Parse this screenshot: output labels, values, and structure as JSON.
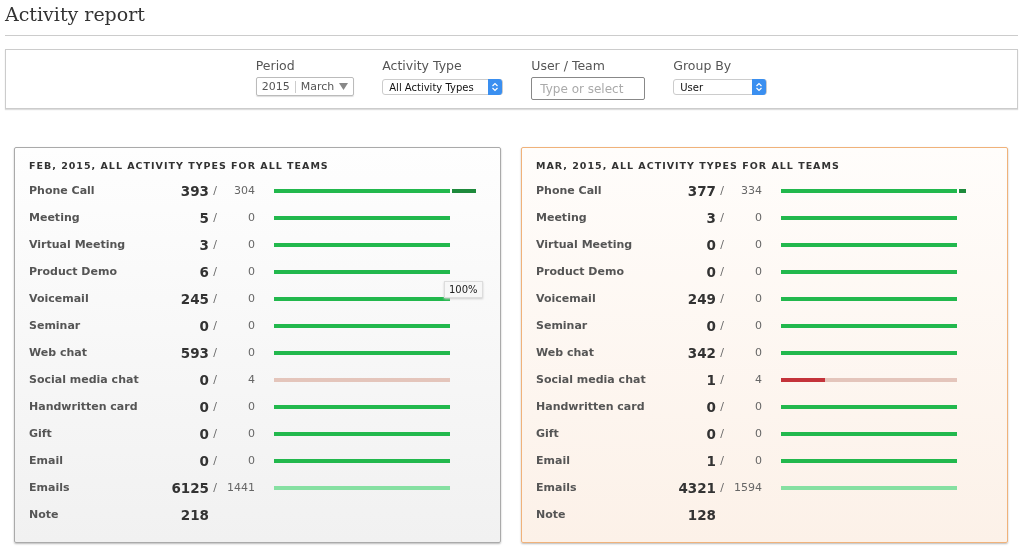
{
  "title": "Activity report",
  "filters": {
    "period": {
      "label": "Period",
      "year": "2015",
      "month": "March"
    },
    "activity_type": {
      "label": "Activity Type",
      "value": "All Activity Types"
    },
    "user_team": {
      "label": "User / Team",
      "placeholder": "Type or select"
    },
    "group_by": {
      "label": "Group By",
      "value": "User"
    }
  },
  "cards": [
    {
      "title": "FEB, 2015, ALL ACTIVITY TYPES FOR ALL TEAMS",
      "selected": false,
      "rows": [
        {
          "label": "Phone Call",
          "actual": "393",
          "separator": "/",
          "target": "304",
          "bar": {
            "kind": "exceeded",
            "level": 0.87
          }
        },
        {
          "label": "Meeting",
          "actual": "5",
          "separator": "/",
          "target": "0",
          "bar": {
            "kind": "met",
            "level": 1
          }
        },
        {
          "label": "Virtual Meeting",
          "actual": "3",
          "separator": "/",
          "target": "0",
          "bar": {
            "kind": "met",
            "level": 1
          }
        },
        {
          "label": "Product Demo",
          "actual": "6",
          "separator": "/",
          "target": "0",
          "bar": {
            "kind": "met",
            "level": 1
          }
        },
        {
          "label": "Voicemail",
          "actual": "245",
          "separator": "/",
          "target": "0",
          "bar": {
            "kind": "met",
            "level": 1
          },
          "tooltip": "100%"
        },
        {
          "label": "Seminar",
          "actual": "0",
          "separator": "/",
          "target": "0",
          "bar": {
            "kind": "met",
            "level": 1
          }
        },
        {
          "label": "Web chat",
          "actual": "593",
          "separator": "/",
          "target": "0",
          "bar": {
            "kind": "met",
            "level": 1
          }
        },
        {
          "label": "Social media chat",
          "actual": "0",
          "separator": "/",
          "target": "4",
          "bar": {
            "kind": "under",
            "level": 0
          }
        },
        {
          "label": "Handwritten card",
          "actual": "0",
          "separator": "/",
          "target": "0",
          "bar": {
            "kind": "met",
            "level": 1
          }
        },
        {
          "label": "Gift",
          "actual": "0",
          "separator": "/",
          "target": "0",
          "bar": {
            "kind": "met",
            "level": 1
          }
        },
        {
          "label": "Email",
          "actual": "0",
          "separator": "/",
          "target": "0",
          "bar": {
            "kind": "met",
            "level": 1
          }
        },
        {
          "label": "Emails",
          "actual": "6125",
          "separator": "/",
          "target": "1441",
          "bar": {
            "kind": "light",
            "level": 1
          }
        },
        {
          "label": "Note",
          "actual": "218"
        }
      ]
    },
    {
      "title": "MAR, 2015, ALL ACTIVITY TYPES FOR ALL TEAMS",
      "selected": true,
      "rows": [
        {
          "label": "Phone Call",
          "actual": "377",
          "separator": "/",
          "target": "334",
          "bar": {
            "kind": "exceeded",
            "level": 0.95
          }
        },
        {
          "label": "Meeting",
          "actual": "3",
          "separator": "/",
          "target": "0",
          "bar": {
            "kind": "met",
            "level": 1
          }
        },
        {
          "label": "Virtual Meeting",
          "actual": "0",
          "separator": "/",
          "target": "0",
          "bar": {
            "kind": "met",
            "level": 1
          }
        },
        {
          "label": "Product Demo",
          "actual": "0",
          "separator": "/",
          "target": "0",
          "bar": {
            "kind": "met",
            "level": 1
          }
        },
        {
          "label": "Voicemail",
          "actual": "249",
          "separator": "/",
          "target": "0",
          "bar": {
            "kind": "met",
            "level": 1
          }
        },
        {
          "label": "Seminar",
          "actual": "0",
          "separator": "/",
          "target": "0",
          "bar": {
            "kind": "met",
            "level": 1
          }
        },
        {
          "label": "Web chat",
          "actual": "342",
          "separator": "/",
          "target": "0",
          "bar": {
            "kind": "met",
            "level": 1
          }
        },
        {
          "label": "Social media chat",
          "actual": "1",
          "separator": "/",
          "target": "4",
          "bar": {
            "kind": "under",
            "level": 0.25
          }
        },
        {
          "label": "Handwritten card",
          "actual": "0",
          "separator": "/",
          "target": "0",
          "bar": {
            "kind": "met",
            "level": 1
          }
        },
        {
          "label": "Gift",
          "actual": "0",
          "separator": "/",
          "target": "0",
          "bar": {
            "kind": "met",
            "level": 1
          }
        },
        {
          "label": "Email",
          "actual": "1",
          "separator": "/",
          "target": "0",
          "bar": {
            "kind": "met",
            "level": 1
          }
        },
        {
          "label": "Emails",
          "actual": "4321",
          "separator": "/",
          "target": "1594",
          "bar": {
            "kind": "light",
            "level": 1
          }
        },
        {
          "label": "Note",
          "actual": "128"
        }
      ]
    }
  ]
}
